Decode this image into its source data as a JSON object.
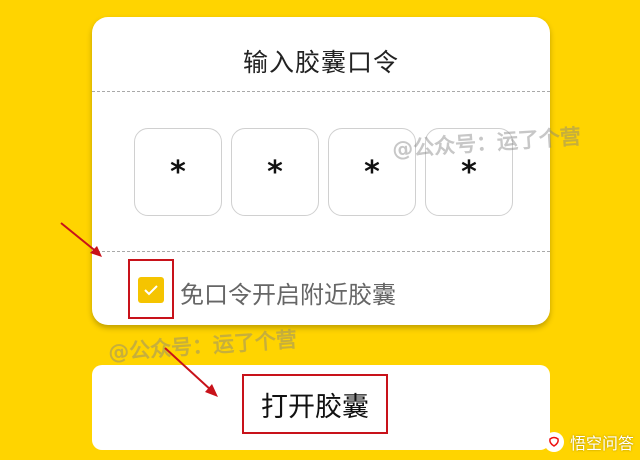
{
  "dialog": {
    "title": "输入胶囊口令",
    "code_chars": [
      "*",
      "*",
      "*",
      "*"
    ],
    "checkbox": {
      "checked": true,
      "label": "免口令开启附近胶囊"
    }
  },
  "action": {
    "open_label": "打开胶囊"
  },
  "watermark": {
    "text": "@公众号：运了个营"
  },
  "footer": {
    "brand": "悟空问答"
  },
  "colors": {
    "background": "#FFD400",
    "checkbox": "#F5C400",
    "highlight": "#C8121A"
  }
}
